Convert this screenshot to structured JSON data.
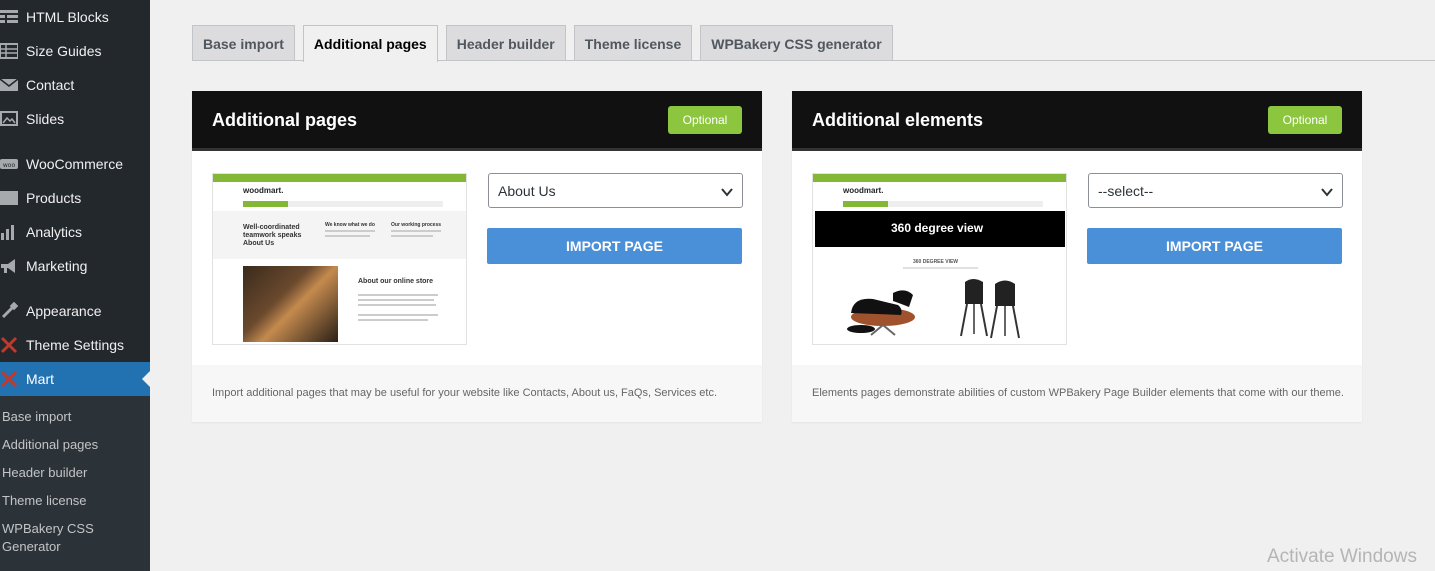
{
  "sidebar": {
    "items": [
      {
        "label": "HTML Blocks",
        "icon": "grid-icon"
      },
      {
        "label": "Size Guides",
        "icon": "table-icon"
      },
      {
        "label": "Contact",
        "icon": "envelope-icon"
      },
      {
        "label": "Slides",
        "icon": "slides-icon"
      },
      {
        "label": "WooCommerce",
        "icon": "woo-icon"
      },
      {
        "label": "Products",
        "icon": "box-icon"
      },
      {
        "label": "Analytics",
        "icon": "bar-chart-icon"
      },
      {
        "label": "Marketing",
        "icon": "megaphone-icon"
      },
      {
        "label": "Appearance",
        "icon": "brush-icon"
      },
      {
        "label": "Theme Settings",
        "icon": "x-icon"
      },
      {
        "label": "Mart",
        "icon": "x-icon"
      }
    ],
    "submenu": [
      "Base import",
      "Additional pages",
      "Header builder",
      "Theme license",
      "WPBakery CSS Generator"
    ]
  },
  "tabs": [
    "Base import",
    "Additional pages",
    "Header builder",
    "Theme license",
    "WPBakery CSS generator"
  ],
  "cards": [
    {
      "title": "Additional pages",
      "badge": "Optional",
      "select_value": "About Us",
      "button": "IMPORT PAGE",
      "description": "Import additional pages that may be useful for your website like Contacts, About us, FaQs, Services etc.",
      "preview": {
        "logo": "woodmart.",
        "heading": "Well-coordinated teamwork speaks About Us",
        "col1": "We know what we do",
        "col2": "Our working process",
        "store": "About our online store"
      }
    },
    {
      "title": "Additional elements",
      "badge": "Optional",
      "select_value": "--select--",
      "button": "IMPORT PAGE",
      "description": "Elements pages demonstrate abilities of custom WPBakery Page Builder elements that come with our theme.",
      "preview": {
        "logo": "woodmart.",
        "banner": "360 degree view",
        "subtitle": "360 DEGREE VIEW"
      }
    }
  ],
  "watermark": "Activate Windows",
  "colors": {
    "accent": "#2271b1",
    "badge": "#8cc63e",
    "button": "#4a90d9",
    "sidebar": "#23282d"
  }
}
